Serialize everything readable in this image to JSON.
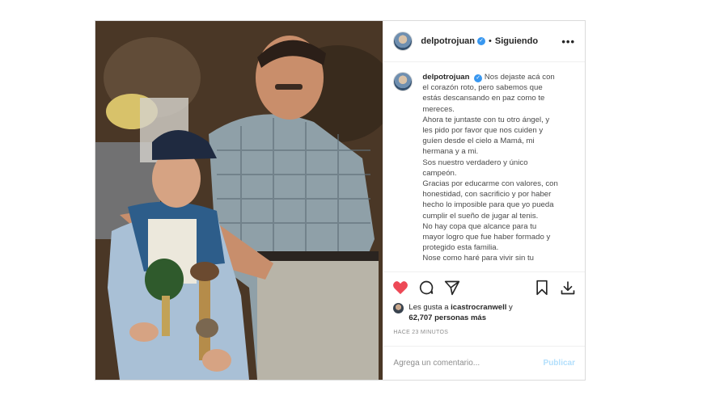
{
  "post": {
    "username": "delpotrojuan",
    "separator": "•",
    "follow_status": "Siguiendo",
    "more_label": "•••",
    "caption_lines": [
      "Nos dejaste acá con el corazón roto, pero sabemos que estás descansando en paz como te mereces.",
      "Ahora te juntaste con tu otro ángel, y les pido por favor que nos cuiden y guíen desde el cielo a Mamá, mi hermana y a mi.",
      "Sos nuestro verdadero y único campeón.",
      "Gracias por educarme con valores, con honestidad, con sacrificio y por haber hecho lo imposible para que yo pueda cumplir el sueño de jugar al tenis.",
      "No hay copa que alcance para tu mayor logro que fue haber formado y protegido esta familia.",
      "Nose como haré para vivir sin tu"
    ],
    "likes_prefix": "Les gusta a",
    "likes_user": "icastrocranwell",
    "likes_suffix": "y",
    "likes_count": "62,707 personas más",
    "timestamp": "HACE 23 MINUTOS",
    "comment_placeholder": "Agrega un comentario...",
    "publish_label": "Publicar",
    "heart_color": "#ed4956",
    "publish_color": "#b2dffc"
  },
  "icons": {
    "heart": "heart-icon",
    "comment": "comment-icon",
    "share": "share-icon",
    "save": "bookmark-icon",
    "download": "download-icon",
    "verified": "verified-badge-icon"
  }
}
